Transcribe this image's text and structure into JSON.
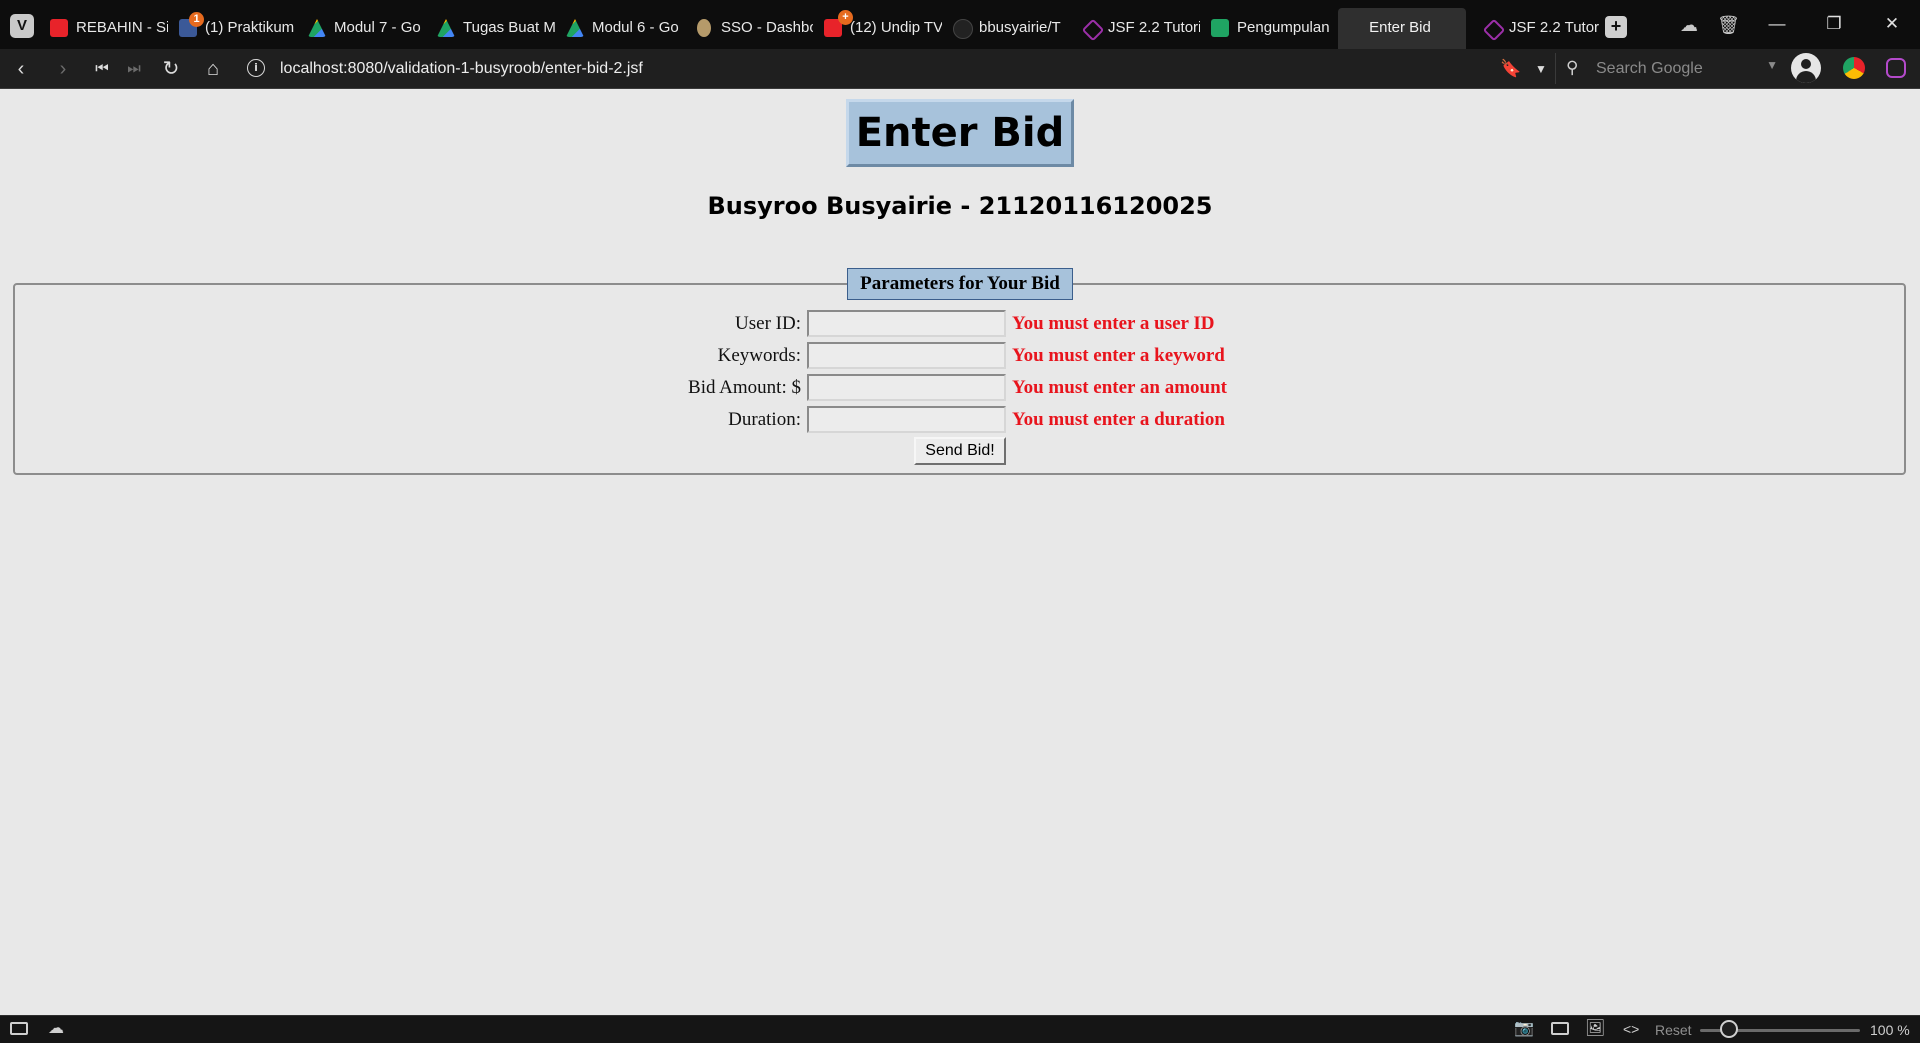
{
  "browser": {
    "tabs": [
      {
        "label": "REBAHIN - Si",
        "icon": "youtube-play-icon",
        "color": "#e8232a"
      },
      {
        "label": "(1) Praktikum",
        "icon": "facebook-icon",
        "color": "#3b5998",
        "badge": "1"
      },
      {
        "label": "Modul 7 - Go",
        "icon": "google-drive-icon",
        "color": "#1fa463"
      },
      {
        "label": "Tugas Buat M",
        "icon": "google-drive-icon",
        "color": "#1fa463"
      },
      {
        "label": "Modul 6 - Go",
        "icon": "google-drive-icon",
        "color": "#1fa463"
      },
      {
        "label": "SSO - Dashbo",
        "icon": "undip-logo-icon",
        "color": "#b59a6a"
      },
      {
        "label": "(12) Undip TV",
        "icon": "youtube-play-icon",
        "color": "#e8232a",
        "badge": "+"
      },
      {
        "label": "bbusyairie/T",
        "icon": "github-icon",
        "color": "#222222"
      },
      {
        "label": "JSF 2.2 Tutori",
        "icon": "jsf-logo-icon",
        "color": "#9b2fa8"
      },
      {
        "label": "Pengumpulan",
        "icon": "google-sheets-icon",
        "color": "#1fa463"
      },
      {
        "label": "Enter Bid",
        "icon": "",
        "color": "",
        "active": true
      },
      {
        "label": "JSF 2.2 Tutor",
        "icon": "jsf-logo-icon",
        "color": "#9b2fa8"
      }
    ],
    "url": "localhost:8080/validation-1-busyroob/enter-bid-2.jsf",
    "search_placeholder": "Search Google",
    "status": {
      "reset_label": "Reset",
      "zoom": "100 %"
    }
  },
  "page": {
    "title": "Enter Bid",
    "subtitle": "Busyroo Busyairie - 21120116120025",
    "legend": "Parameters for Your Bid",
    "fields": [
      {
        "label": "User ID:",
        "value": "",
        "error": "You must enter a user ID"
      },
      {
        "label": "Keywords:",
        "value": "",
        "error": "You must enter a keyword"
      },
      {
        "label": "Bid Amount: $",
        "value": "",
        "error": "You must enter an amount"
      },
      {
        "label": "Duration:",
        "value": "",
        "error": "You must enter a duration"
      }
    ],
    "submit_label": "Send Bid!"
  }
}
